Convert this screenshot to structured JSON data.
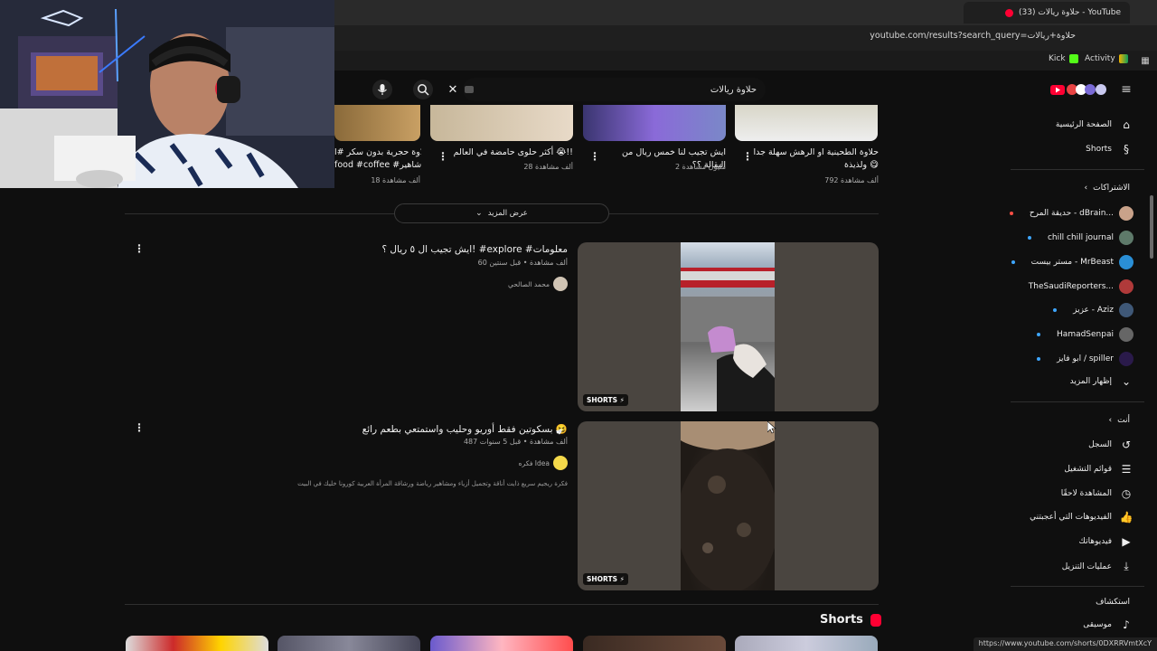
{
  "browser": {
    "tab_title": "(33) حلاوة ريالات - YouTube",
    "url": "youtube.com/results?search_query=حلاوة+ريالات",
    "bookmarks": [
      "Kick",
      "Activity"
    ],
    "status_url": "https://www.youtube.com/shorts/0DXRRVmtXcY"
  },
  "header": {
    "search_value": "حلاوة ريالات"
  },
  "top_row": [
    {
      "title_1": "حلاوة الطحينية او الرهش سهلة جدا",
      "title_2": "ولذيذة 😋",
      "meta": "792 ألف مشاهدة"
    },
    {
      "title_1": "ايش تجيب لنا خمس ريال من البقالة ؟؟",
      "title_2": "",
      "meta": "2 مليون مشاهدة"
    },
    {
      "title_1": "أكثر حلوى حامضة في العالم 😭!!",
      "title_2": "",
      "meta": "28 ألف مشاهدة"
    },
    {
      "title_1": "حلاوة حجرية بدون سكر #ا",
      "title_2": "food #coffee #شاهير",
      "meta": "18 ألف مشاهدة"
    }
  ],
  "show_more_label": "عرض المزيد",
  "results": [
    {
      "title": "ايش تجيب ال ٥ ريال ؟! #explore #معلومات",
      "meta": "60 ألف مشاهدة • قبل سنتين",
      "channel": "محمد الصالحي",
      "badge": "SHORTS",
      "description": ""
    },
    {
      "title": "بسكوتين فقط أوريو وحليب واستمتعي بطعم رائع 🤧",
      "meta": "487 ألف مشاهدة • قبل 5 سنوات",
      "channel": "فكره Idea",
      "badge": "SHORTS",
      "description": "فكرة ريجيم سريع ذايت أناقة وتجميل أزياء ومشاهير رياضة ورشاقة المرأة العربية كورونا خليك في البيت"
    }
  ],
  "shorts_shelf_label": "Shorts",
  "sidebar": {
    "main": [
      {
        "label": "الصفحة الرئيسية",
        "icon": "home-icon"
      },
      {
        "label": "Shorts",
        "icon": "shorts-icon"
      }
    ],
    "subscriptions_header": "الاشتراكات",
    "subscriptions": [
      {
        "label": "حديقة المرح - dBrain...",
        "color": "#c9a28a"
      },
      {
        "label": "chill chill journal",
        "color": "#5e7a6a"
      },
      {
        "label": "مستر بيست - MrBeast",
        "color": "#2a8fd6"
      },
      {
        "label": "TheSaudiReporters...",
        "color": "#b03a3a"
      },
      {
        "label": "عزيز - Aziz",
        "color": "#3f5877"
      },
      {
        "label": "HamadSenpai",
        "color": "#666666"
      },
      {
        "label": "ابو فايز / spiller",
        "color": "#2a1a4a"
      }
    ],
    "show_more_subs": "إظهار المزيد",
    "you_header": "أنت",
    "you_items": [
      {
        "label": "السجل",
        "icon": "history-icon"
      },
      {
        "label": "قوائم التشغيل",
        "icon": "playlist-icon"
      },
      {
        "label": "المشاهدة لاحقًا",
        "icon": "clock-icon"
      },
      {
        "label": "الفيديوهات التي أعجبتني",
        "icon": "like-icon"
      },
      {
        "label": "فيديوهاتك",
        "icon": "video-icon"
      },
      {
        "label": "عمليات التنزيل",
        "icon": "download-icon"
      }
    ],
    "explore_header": "استكشاف",
    "explore_items": [
      {
        "label": "موسيقى",
        "icon": "music-icon"
      }
    ]
  }
}
